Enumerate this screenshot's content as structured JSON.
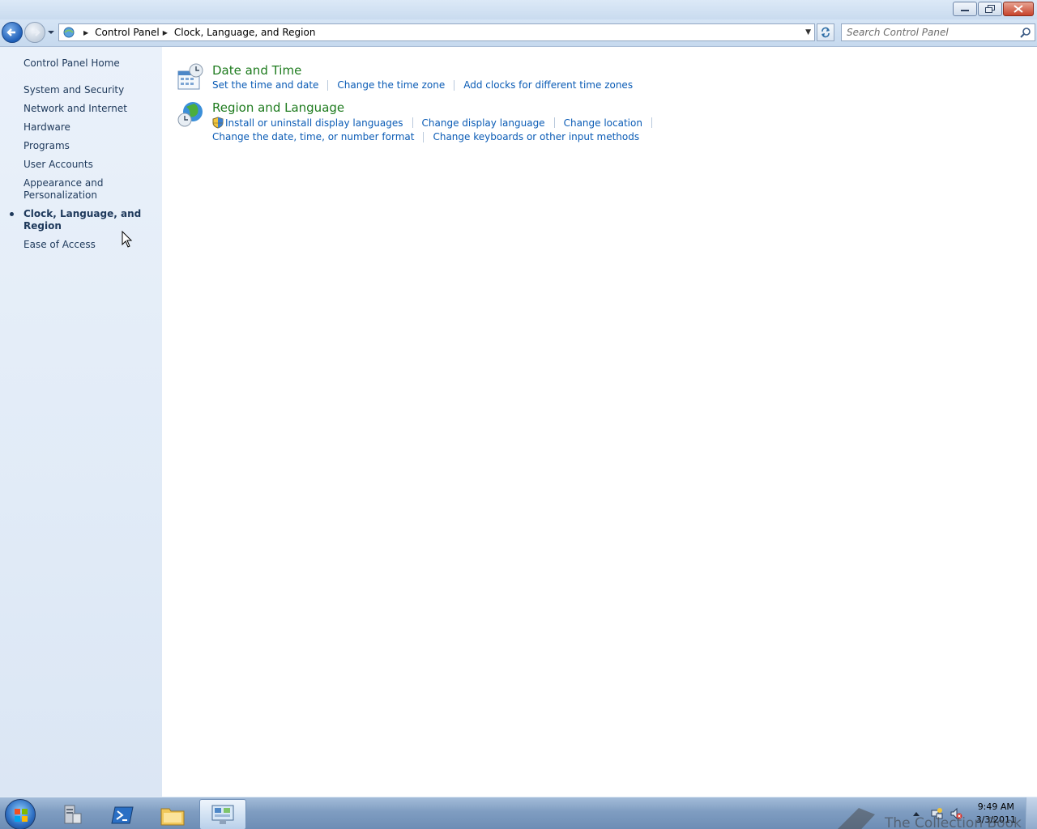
{
  "window": {
    "controls": [
      "minimize",
      "restore",
      "close"
    ]
  },
  "navbar": {
    "breadcrumb": [
      "Control Panel",
      "Clock, Language, and Region"
    ],
    "search_placeholder": "Search Control Panel"
  },
  "sidebar": {
    "home": "Control Panel Home",
    "items": [
      {
        "label": "System and Security",
        "active": false
      },
      {
        "label": "Network and Internet",
        "active": false
      },
      {
        "label": "Hardware",
        "active": false
      },
      {
        "label": "Programs",
        "active": false
      },
      {
        "label": "User Accounts",
        "active": false
      },
      {
        "label": "Appearance and Personalization",
        "active": false
      },
      {
        "label": "Clock, Language, and Region",
        "active": true
      },
      {
        "label": "Ease of Access",
        "active": false
      }
    ]
  },
  "main": {
    "categories": [
      {
        "title": "Date and Time",
        "icon": "calendar-clock-icon",
        "link_rows": [
          [
            "Set the time and date",
            "Change the time zone",
            "Add clocks for different time zones"
          ]
        ]
      },
      {
        "title": "Region and Language",
        "icon": "globe-clock-icon",
        "link_rows": [
          [
            "Install or uninstall display languages",
            "Change display language",
            "Change location"
          ],
          [
            "Change the date, time, or number format",
            "Change keyboards or other input methods"
          ]
        ]
      }
    ]
  },
  "taskbar": {
    "clock_time": "9:49 AM",
    "clock_date": "3/3/2011",
    "watermark": "The Collection Book"
  },
  "colors": {
    "category_title": "#1e7b1e",
    "link": "#0a5bb5",
    "sidebar_text": "#1e395b"
  }
}
